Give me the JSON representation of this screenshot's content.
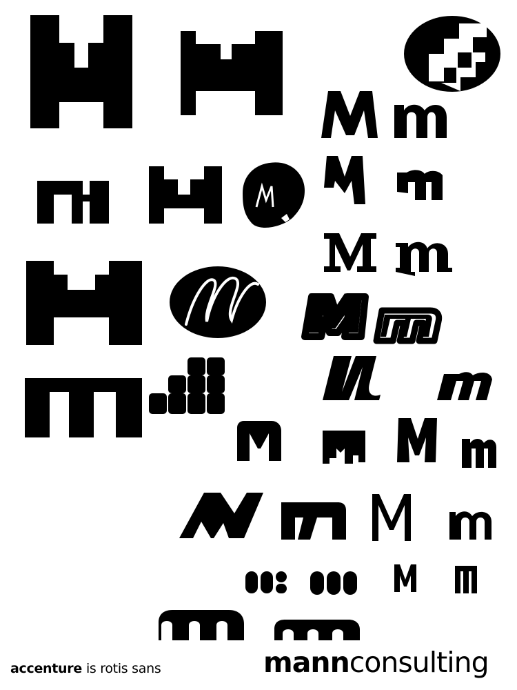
{
  "footer": {
    "left_brand": "accenture",
    "left_rest": "is rotis sans",
    "right_bold": "mann",
    "right_light": "consulting"
  },
  "colors": {
    "ink": "#000000",
    "paper": "#ffffff"
  },
  "logo_marks": [
    "pixel-M-large",
    "pixel-M-medium",
    "circle-step-mark",
    "sans-M",
    "sans-m",
    "pixel-m-small",
    "pixel-M-small",
    "brush-circle-m",
    "angular-M",
    "angular-m",
    "serif-M",
    "serif-m",
    "pixel-M-tall",
    "oval-script-m",
    "outlined-M",
    "outlined-m",
    "pixel-m-wide",
    "rounded-block-stairs",
    "italic-slab-M",
    "italic-slab-m",
    "rounded-M",
    "drip-m",
    "rough-M",
    "rough-m",
    "geometric-M",
    "geometric-m",
    "light-M",
    "light-m",
    "pill-m-1",
    "pill-m-2",
    "condensed-M",
    "condensed-m",
    "arch-m-1",
    "arch-m-2"
  ]
}
